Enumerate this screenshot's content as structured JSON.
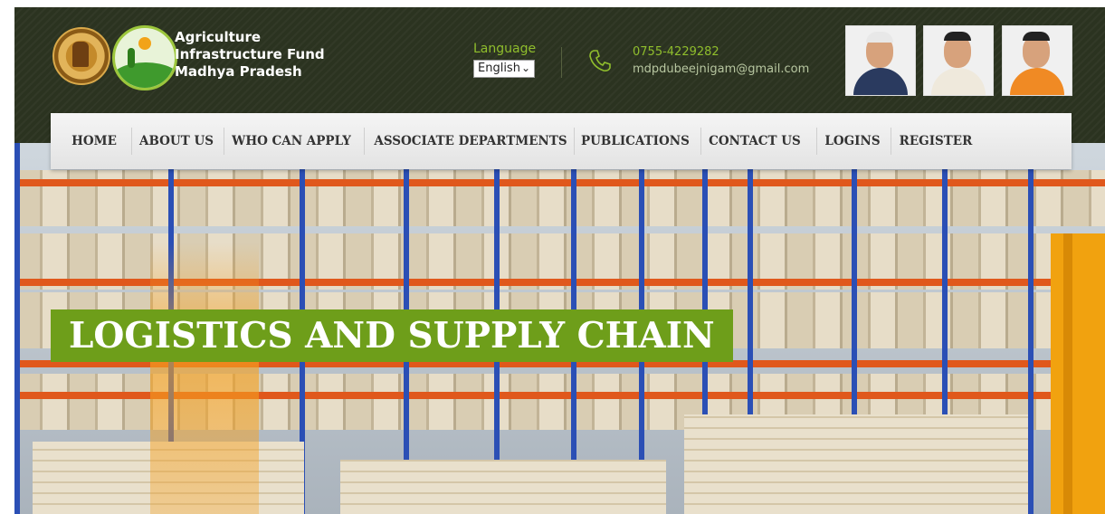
{
  "header": {
    "brand_lines": [
      "Agriculture",
      "Infrastructure Fund",
      "Madhya Pradesh"
    ],
    "language": {
      "label": "Language",
      "selected": "English"
    },
    "contact": {
      "phone": "0755-4229282",
      "email": "mdpdubeejnigam@gmail.com"
    },
    "icons": [
      "state-emblem",
      "aif-logo",
      "phone-icon",
      "chevron-down-icon"
    ]
  },
  "nav": {
    "items": [
      "HOME",
      "ABOUT US",
      "WHO CAN APPLY",
      "ASSOCIATE DEPARTMENTS",
      "PUBLICATIONS",
      "CONTACT US",
      "LOGINS",
      "REGISTER"
    ]
  },
  "banner": {
    "headline": "LOGISTICS AND SUPPLY CHAIN"
  },
  "colors": {
    "header_bg": "#2b3320",
    "accent_green": "#8fbd2c",
    "headline_bg": "#6e9e1a",
    "nav_bg": "#ebebeb"
  }
}
